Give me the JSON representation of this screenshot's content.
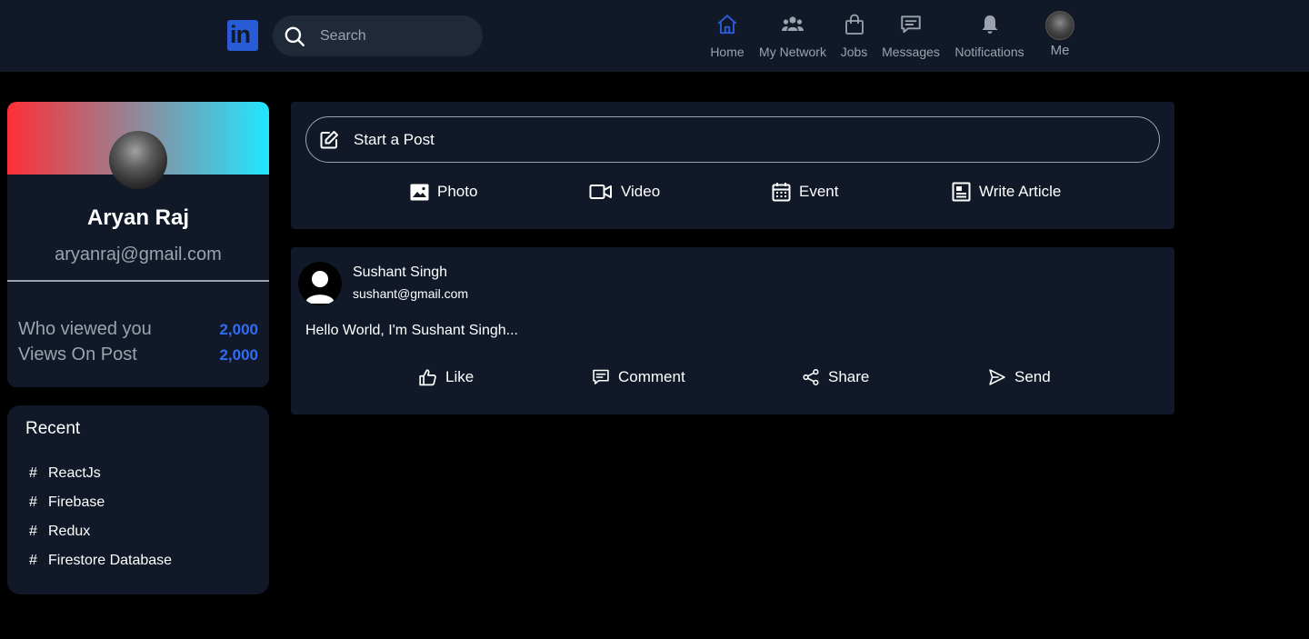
{
  "header": {
    "logo_text": "in",
    "search_placeholder": "Search",
    "nav": [
      {
        "label": "Home",
        "icon": "home-icon",
        "active": true
      },
      {
        "label": "My Network",
        "icon": "network-icon"
      },
      {
        "label": "Jobs",
        "icon": "briefcase-icon"
      },
      {
        "label": "Messages",
        "icon": "message-icon"
      },
      {
        "label": "Notifications",
        "icon": "bell-icon"
      },
      {
        "label": "Me",
        "icon": "avatar"
      }
    ]
  },
  "profile": {
    "name": "Aryan Raj",
    "email": "aryanraj@gmail.com",
    "stats": [
      {
        "label": "Who viewed you",
        "value": "2,000"
      },
      {
        "label": "Views On Post",
        "value": "2,000"
      }
    ]
  },
  "recent": {
    "title": "Recent",
    "items": [
      {
        "hash": "#",
        "label": "ReactJs"
      },
      {
        "hash": "#",
        "label": "Firebase"
      },
      {
        "hash": "#",
        "label": "Redux"
      },
      {
        "hash": "#",
        "label": "Firestore Database"
      }
    ]
  },
  "composer": {
    "start_post_label": "Start a Post",
    "actions": [
      {
        "label": "Photo",
        "icon": "photo-icon"
      },
      {
        "label": "Video",
        "icon": "video-icon"
      },
      {
        "label": "Event",
        "icon": "calendar-icon"
      },
      {
        "label": "Write Article",
        "icon": "article-icon"
      }
    ]
  },
  "post": {
    "author": "Sushant Singh",
    "email": "sushant@gmail.com",
    "body": "Hello World, I'm Sushant Singh...",
    "actions": [
      {
        "label": "Like",
        "icon": "thumbs-up-icon"
      },
      {
        "label": "Comment",
        "icon": "comment-icon"
      },
      {
        "label": "Share",
        "icon": "share-icon"
      },
      {
        "label": "Send",
        "icon": "send-icon"
      }
    ]
  },
  "colors": {
    "background": "#000000",
    "card": "#111827",
    "search_bg": "#1f2937",
    "accent": "#2f6df6",
    "nav_active": "#2a5bd7",
    "muted_text": "#9ca3af",
    "banner_start": "#ff2e36",
    "banner_end": "#20e6ff"
  }
}
